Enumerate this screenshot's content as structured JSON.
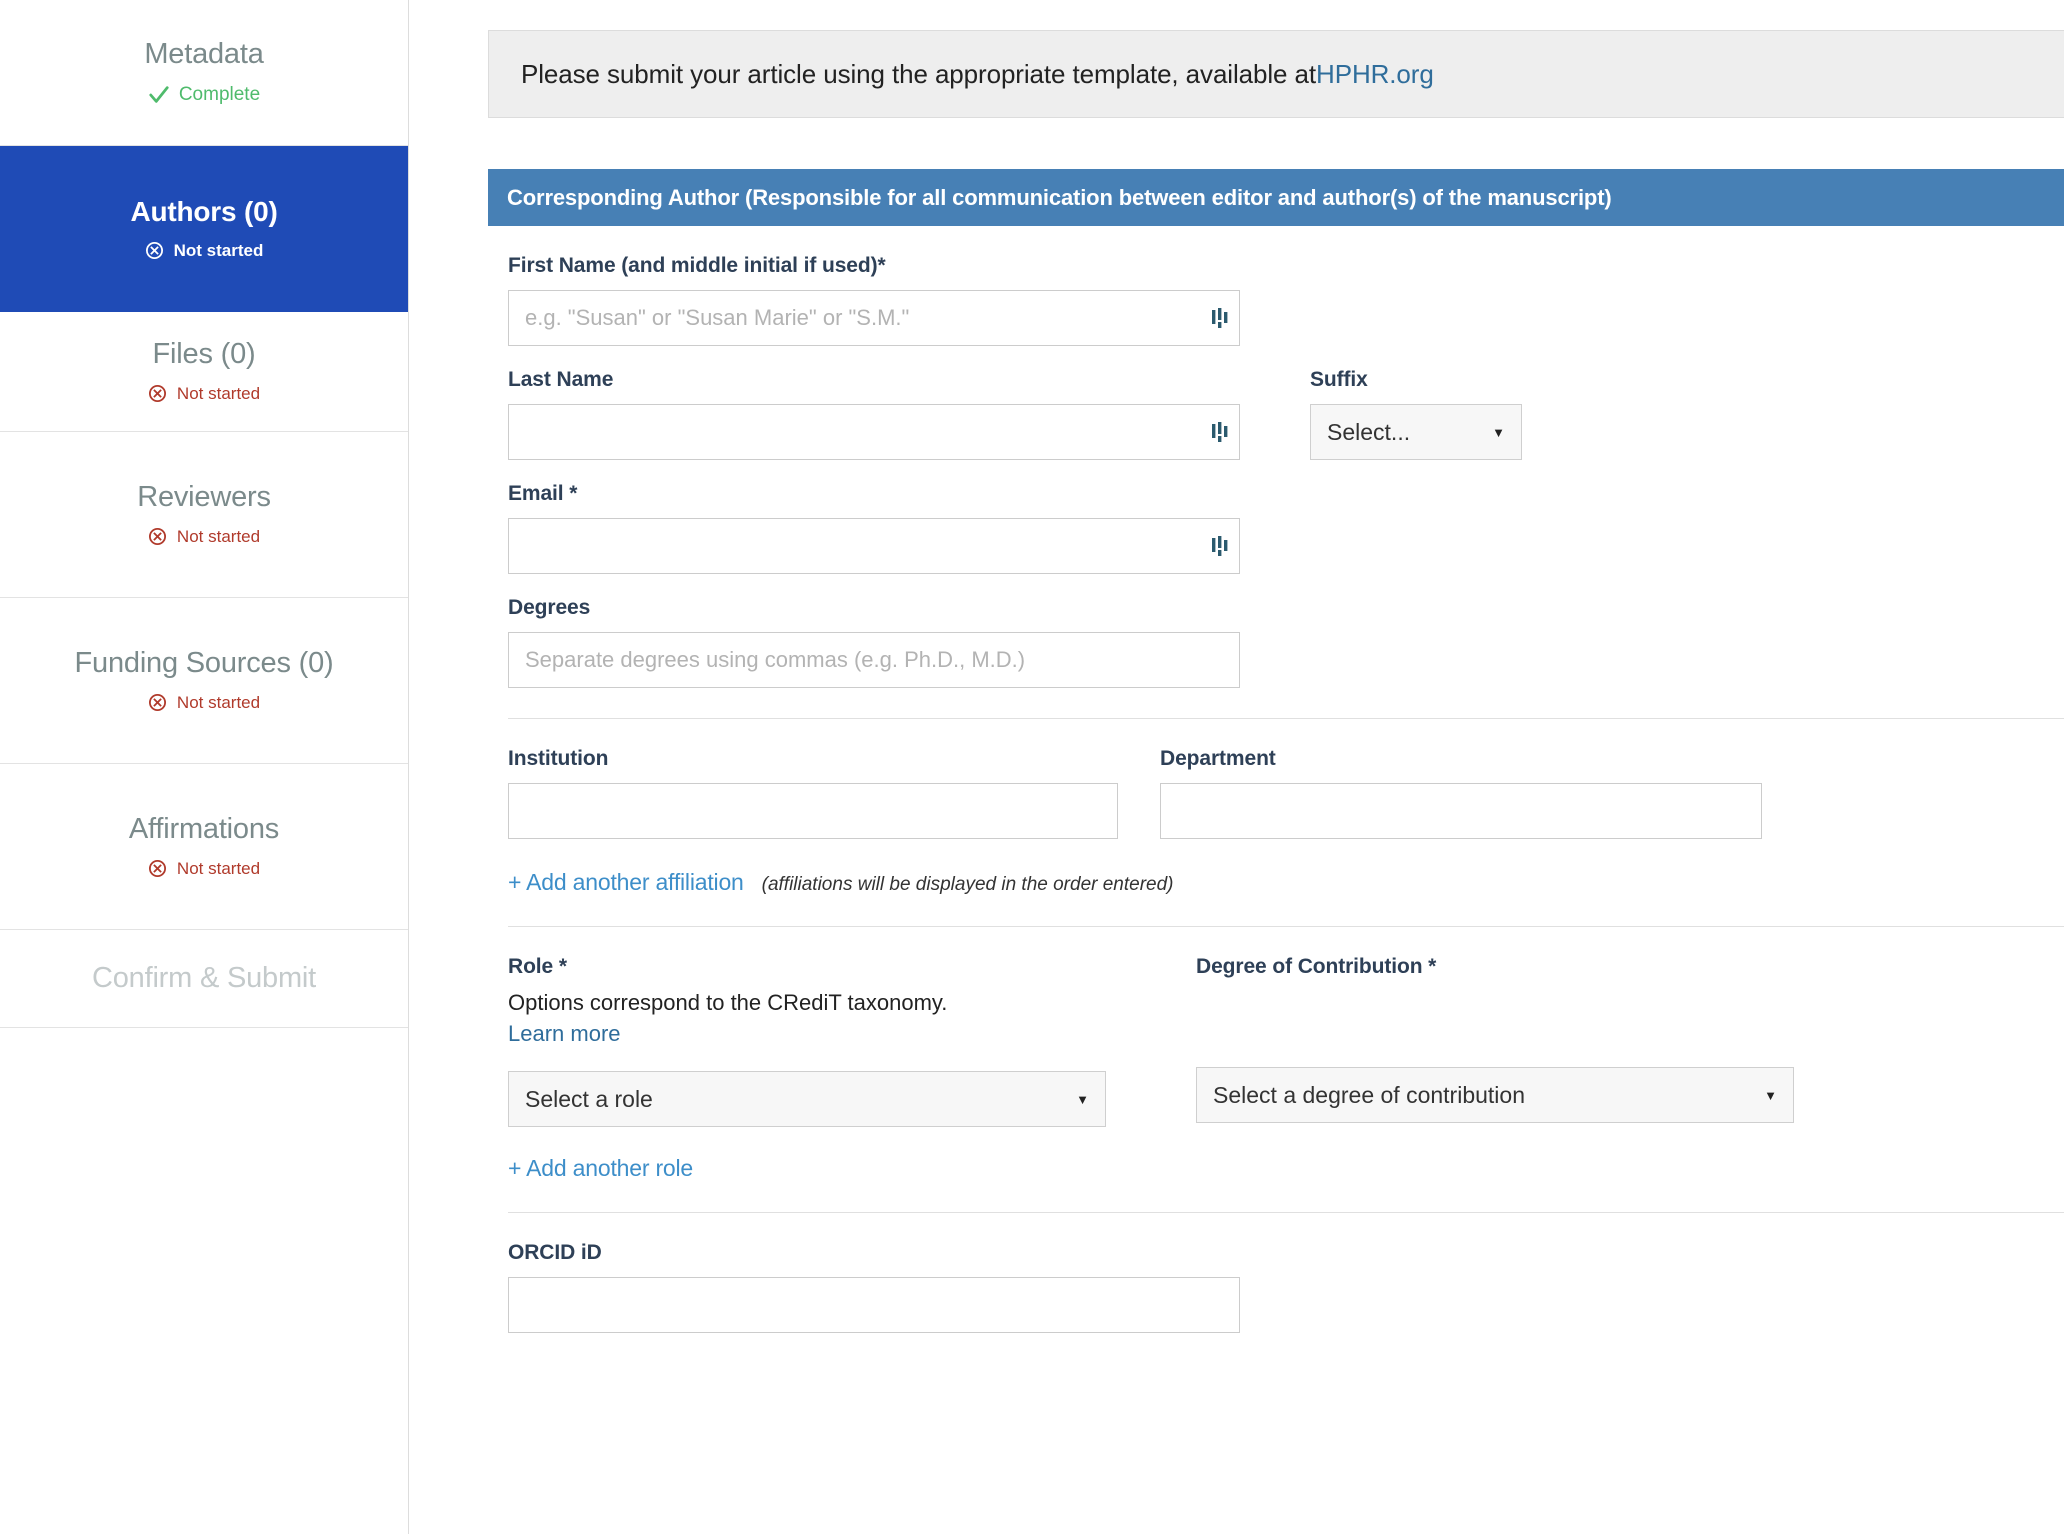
{
  "sidebar": {
    "items": [
      {
        "title": "Metadata",
        "status": "Complete",
        "state": "complete"
      },
      {
        "title": "Authors (0)",
        "status": "Not started",
        "state": "active"
      },
      {
        "title": "Files (0)",
        "status": "Not started",
        "state": "notstarted"
      },
      {
        "title": "Reviewers",
        "status": "Not started",
        "state": "notstarted"
      },
      {
        "title": "Funding Sources (0)",
        "status": "Not started",
        "state": "notstarted"
      },
      {
        "title": "Affirmations",
        "status": "Not started",
        "state": "notstarted"
      },
      {
        "title": "Confirm & Submit",
        "status": "",
        "state": "disabled"
      }
    ]
  },
  "notice": {
    "text_before": "Please submit your article using the appropriate template, available at ",
    "link_label": "HPHR.org"
  },
  "section": {
    "header": "Corresponding Author (Responsible for all communication between editor and author(s) of the manuscript)"
  },
  "form": {
    "first_name": {
      "label": "First Name (and middle initial if used)*",
      "placeholder": "e.g. \"Susan\" or \"Susan Marie\" or \"S.M.\"",
      "value": ""
    },
    "last_name": {
      "label": "Last Name",
      "placeholder": "",
      "value": ""
    },
    "suffix": {
      "label": "Suffix",
      "selected": "Select..."
    },
    "email": {
      "label": "Email *",
      "placeholder": "",
      "value": ""
    },
    "degrees": {
      "label": "Degrees",
      "placeholder": "Separate degrees using commas (e.g. Ph.D., M.D.)",
      "value": ""
    },
    "institution": {
      "label": "Institution",
      "placeholder": "",
      "value": ""
    },
    "department": {
      "label": "Department",
      "placeholder": "",
      "value": ""
    },
    "add_affiliation": {
      "label": "+ Add another affiliation",
      "note": "(affiliations will be displayed in the order entered)"
    },
    "role": {
      "label": "Role *",
      "help_text": "Options correspond to the CRediT taxonomy. ",
      "help_link": "Learn more",
      "selected": "Select a role"
    },
    "degree_of_contribution": {
      "label": "Degree of Contribution *",
      "selected": "Select a degree of contribution"
    },
    "add_role": {
      "label": "+ Add another role"
    },
    "orcid": {
      "label": "ORCID iD",
      "placeholder": "",
      "value": ""
    }
  },
  "colors": {
    "sidebar_active": "#1f4bb6",
    "section_header": "#4780b5",
    "link": "#2f6d9b",
    "add_link": "#3d8ec9",
    "status_error": "#b03a2b",
    "status_ok": "#4fbb6c"
  }
}
